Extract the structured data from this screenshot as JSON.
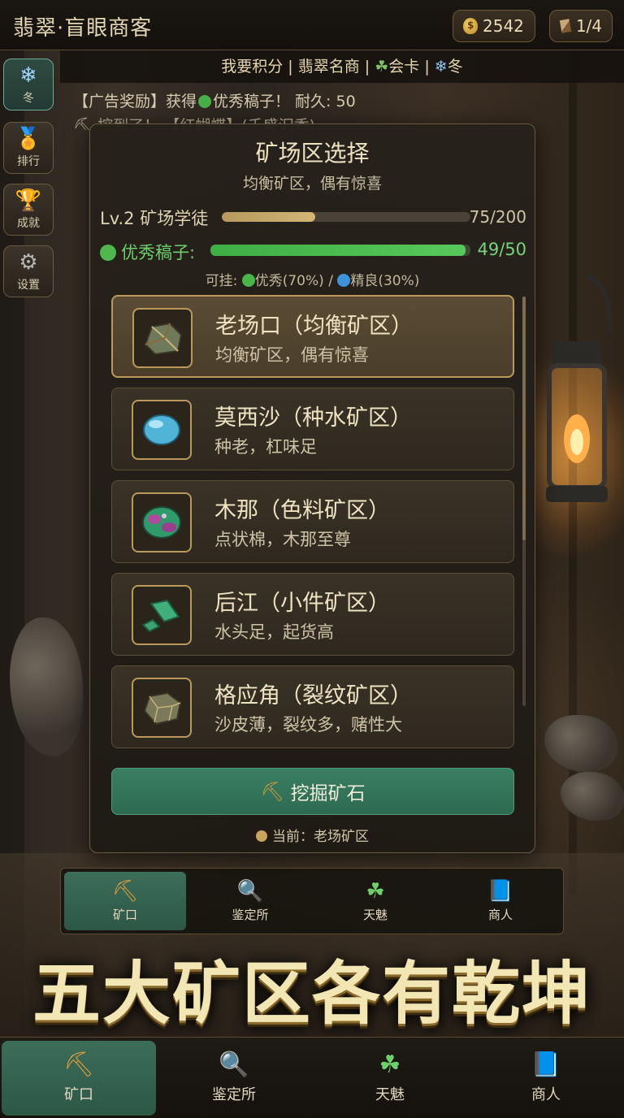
{
  "header": {
    "title": "翡翠·盲眼商客",
    "coins": "2542",
    "pages": "1/4"
  },
  "infobar": {
    "part1": "我要积分 | 翡翠名商 | ",
    "part2": "会卡",
    "part3": " | ",
    "part4": "冬"
  },
  "ticker": {
    "line1_a": "【广告奖励】获得",
    "line1_b": "优秀稿子！ 耐久: 50",
    "line2": "挖到了！ 【红蝴蝶】(千盛汩香)"
  },
  "side_buttons": [
    {
      "label": "冬",
      "icon": "snowflake-icon"
    },
    {
      "label": "排行",
      "icon": "medal-icon"
    },
    {
      "label": "成就",
      "icon": "trophy-icon"
    },
    {
      "label": "设置",
      "icon": "gear-icon"
    }
  ],
  "modal": {
    "title": "矿场区选择",
    "subtitle": "均衡矿区，偶有惊喜",
    "level_label": "Lv.2 矿场学徒",
    "level_value": "75/200",
    "level_progress": 0.375,
    "tool_label": "优秀稿子:",
    "tool_value": "49/50",
    "tool_progress": 0.98,
    "carry_a": "可挂: ",
    "carry_b": "优秀(70%) / ",
    "carry_c": "精良(30%)",
    "zones": [
      {
        "name": "老场口（均衡矿区）",
        "desc": "均衡矿区，偶有惊喜",
        "selected": true
      },
      {
        "name": "莫西沙（种水矿区）",
        "desc": "种老，杠味足",
        "selected": false
      },
      {
        "name": "木那（色料矿区）",
        "desc": "点状棉，木那至尊",
        "selected": false
      },
      {
        "name": "后江（小件矿区）",
        "desc": "水头足，起货高",
        "selected": false
      },
      {
        "name": "格应角（裂纹矿区）",
        "desc": "沙皮薄，裂纹多，赌性大",
        "selected": false
      }
    ],
    "dig_button": "挖掘矿石",
    "current": "当前：老场矿区"
  },
  "inner_nav": [
    {
      "label": "矿口",
      "icon": "pickaxe-icon",
      "active": true
    },
    {
      "label": "鉴定所",
      "icon": "magnifier-icon",
      "active": false
    },
    {
      "label": "天魅",
      "icon": "leaf-icon",
      "active": false
    },
    {
      "label": "商人",
      "icon": "notebook-icon",
      "active": false
    }
  ],
  "banner": "五大矿区各有乾坤",
  "bottom_nav": [
    {
      "label": "矿口",
      "icon": "pickaxe-icon",
      "active": true
    },
    {
      "label": "鉴定所",
      "icon": "magnifier-icon",
      "active": false
    },
    {
      "label": "天魅",
      "icon": "leaf-icon",
      "active": false
    },
    {
      "label": "商人",
      "icon": "notebook-icon",
      "active": false
    }
  ],
  "colors": {
    "accent_green": "#2d6a52",
    "gold_border": "#b99a5c",
    "progress_green": "#4fb84c"
  }
}
